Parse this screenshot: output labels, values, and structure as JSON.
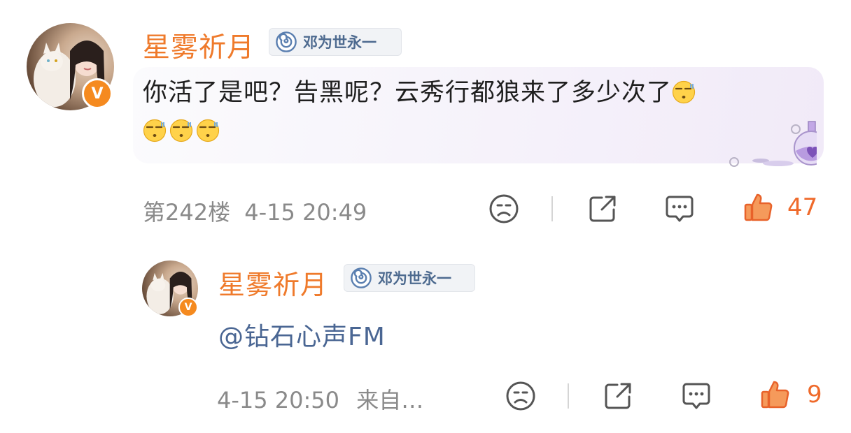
{
  "comment": {
    "user": {
      "name": "星雾祈月",
      "verified_badge": "V",
      "fan_badge_text": "邓为世永一"
    },
    "text": "你活了是吧？告黑呢？云秀行都狼来了多少次了",
    "emoji_count_trailing": 4,
    "floor": "第242楼",
    "timestamp": "4-15 20:49",
    "likes": "47",
    "accent_color": "#ef7a2b"
  },
  "reply": {
    "user": {
      "name": "星雾祈月",
      "verified_badge": "V",
      "fan_badge_text": "邓为世永一"
    },
    "text": "@钻石心声FM",
    "timestamp": "4-15 20:50",
    "source": "来自…",
    "likes": "9"
  },
  "icons": [
    "sad-face-icon",
    "share-icon",
    "comment-icon",
    "thumbs-up-icon",
    "lollipop-icon"
  ]
}
